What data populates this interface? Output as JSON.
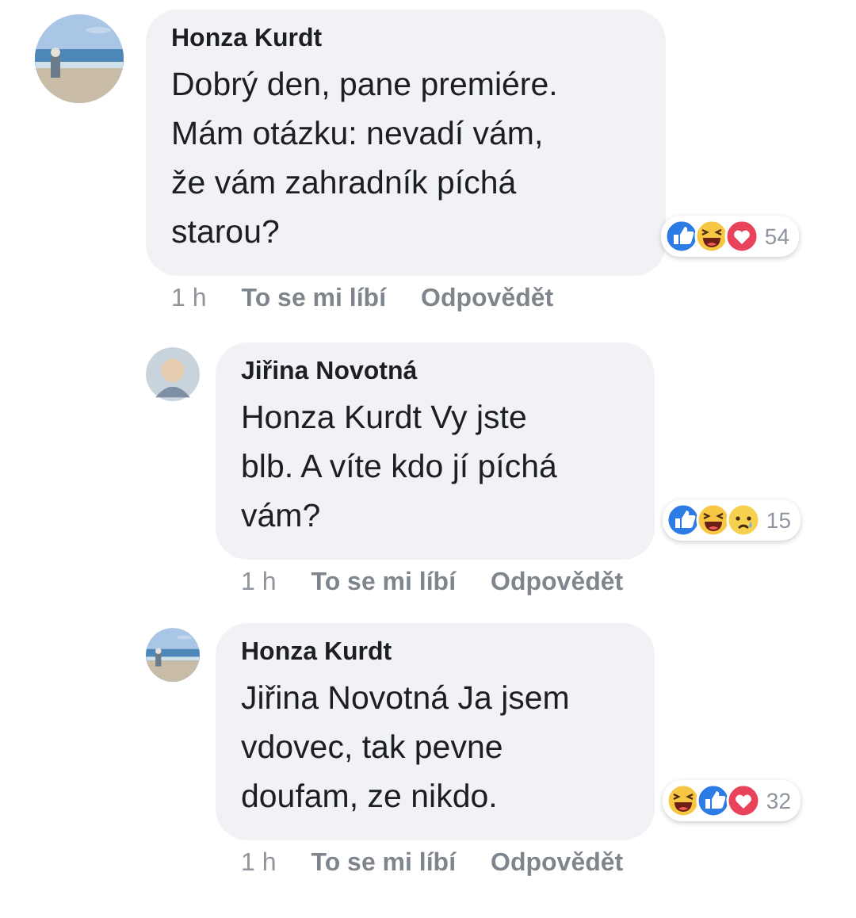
{
  "comments": [
    {
      "author": "Honza Kurdt",
      "avatar": {
        "kind": "picture"
      },
      "text": "Dobrý den, pane premiére.\nMám otázku: nevadí vám,\nže vám zahradník píchá\nstarou?",
      "reactions": [
        {
          "kind": "like"
        },
        {
          "kind": "haha"
        },
        {
          "kind": "love"
        }
      ],
      "reaction_count": "54",
      "time": "1 h",
      "actions": [
        "To se mi líbí",
        "Odpovědět"
      ],
      "replies": [
        {
          "author": "Jiřina Novotná",
          "avatar": {
            "kind": "person"
          },
          "text": "Honza Kurdt Vy jste\nblb. A víte kdo jí píchá\nvám?",
          "reactions": [
            {
              "kind": "like"
            },
            {
              "kind": "haha"
            },
            {
              "kind": "sad"
            }
          ],
          "reaction_count": "15",
          "time": "1 h",
          "actions": [
            "To se mi líbí",
            "Odpovědět"
          ]
        },
        {
          "author": "Honza Kurdt",
          "avatar": {
            "kind": "picture"
          },
          "text": "Jiřina Novotná Ja jsem\nvdovec, tak pevne\ndoufam, ze nikdo.",
          "reactions": [
            {
              "kind": "haha"
            },
            {
              "kind": "like"
            },
            {
              "kind": "love"
            }
          ],
          "reaction_count": "32",
          "time": "1 h",
          "actions": [
            "To se mi líbí",
            "Odpovědět"
          ]
        }
      ]
    }
  ]
}
